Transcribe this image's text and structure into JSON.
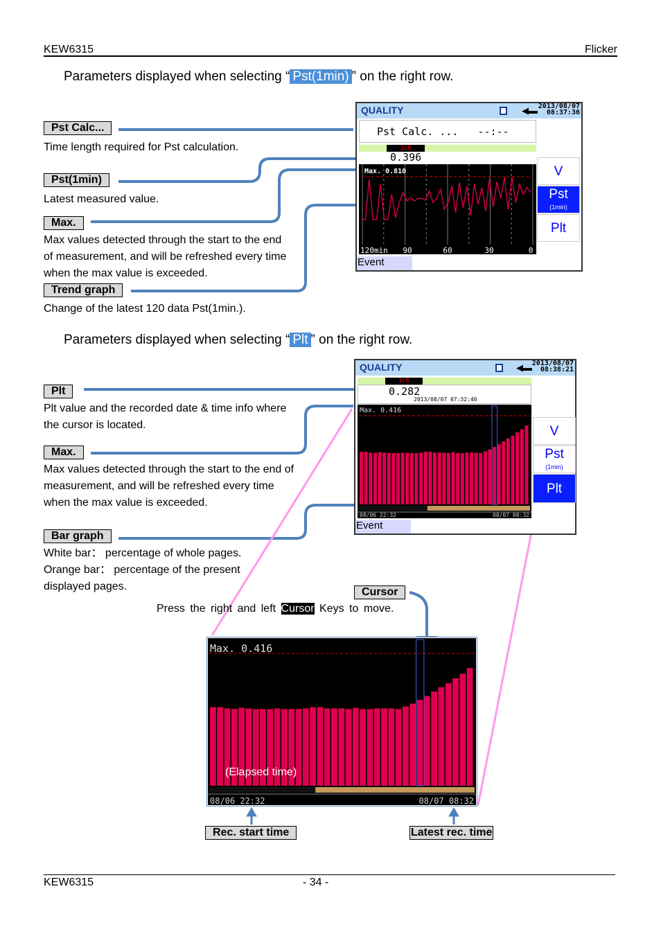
{
  "header": {
    "left": "KEW6315",
    "right": "Flicker"
  },
  "footer": {
    "left": "KEW6315",
    "page": "- 34 -"
  },
  "section1": {
    "pre": "Parameters displayed when selecting “",
    "hl": "Pst(1min)",
    "post": "” on the right row.",
    "items": [
      {
        "label": "Pst Calc...",
        "desc": [
          "Time length required for Pst calculation."
        ]
      },
      {
        "label": "Pst(1min)",
        "desc": [
          "Latest measured value."
        ]
      },
      {
        "label": "Max.",
        "desc": [
          "Max values detected through the start to the end",
          "of measurement, and will be refreshed every time",
          "when the max value is exceeded."
        ]
      },
      {
        "label": "Trend graph",
        "desc": [
          "Change of the latest 120 data Pst(1min.)."
        ]
      }
    ]
  },
  "section2": {
    "pre": "Parameters displayed when selecting “",
    "hl": "Plt",
    "post": "” on the right row.",
    "items": [
      {
        "label": "Plt",
        "desc": [
          "Plt value and the recorded date & time info where",
          "the cursor is located."
        ]
      },
      {
        "label": "Max.",
        "desc": [
          "Max values detected through the start to the end of",
          "measurement, and will be refreshed every time",
          "when the max value is exceeded."
        ]
      },
      {
        "label": "Bar graph",
        "desc": [
          "White bar： percentage of whole pages.",
          "Orange bar： percentage of the present",
          "displayed pages."
        ]
      }
    ]
  },
  "cursor": {
    "label": "Cursor",
    "pre": "Press  the  right  and  left",
    "key": "Cursor",
    "post": "Keys  to  move."
  },
  "zoom": {
    "max": "Max. 0.416",
    "elapsed": "(Elapsed time)",
    "start": "08/06 22:32",
    "end": "08/07 08:32",
    "start_label": "Rec. start time",
    "end_label": "Latest rec. time"
  },
  "screen1": {
    "title": "QUALITY",
    "date": "2013/08/07",
    "time": "08:37:36",
    "calc_label": "Pst Calc. ...",
    "calc_value": "--:--",
    "channel": "1ch",
    "value": "0.396",
    "max": "Max. 0.810",
    "xticks": [
      "120min",
      "90",
      "60",
      "30",
      "0"
    ],
    "event": "Event",
    "side": [
      "V",
      "Pst",
      "(1min)",
      "Plt"
    ],
    "trend": [
      0.3,
      0.3,
      0.78,
      0.3,
      0.3,
      0.72,
      0.3,
      0.3,
      0.6,
      0.32,
      0.5,
      0.62,
      0.52,
      0.56,
      0.52,
      0.55,
      0.55,
      0.53,
      0.64,
      0.5,
      0.56,
      0.66,
      0.42,
      0.5,
      0.7,
      0.38,
      0.74,
      0.44,
      0.7,
      0.35,
      0.72,
      0.48,
      0.68,
      0.4,
      0.78,
      0.45,
      0.75,
      0.55,
      0.8,
      0.42,
      0.81,
      0.5,
      0.72,
      0.6,
      0.68,
      0.62
    ]
  },
  "screen2": {
    "title": "QUALITY",
    "date": "2013/08/07",
    "time": "08:38:21",
    "channel": "1ch",
    "value": "0.282",
    "value_time": "2013/08/07 07:32:46",
    "max": "Max. 0.416",
    "start": "08/06 22:32",
    "end": "08/07 08:32",
    "event": "Event",
    "side": [
      "V",
      "Pst",
      "(1min)",
      "Plt"
    ],
    "plt_max": 0.416,
    "bars": [
      0.247,
      0.247,
      0.243,
      0.241,
      0.245,
      0.243,
      0.241,
      0.241,
      0.241,
      0.243,
      0.241,
      0.241,
      0.241,
      0.243,
      0.247,
      0.247,
      0.243,
      0.243,
      0.243,
      0.241,
      0.245,
      0.241,
      0.241,
      0.243,
      0.243,
      0.243,
      0.241,
      0.249,
      0.258,
      0.27,
      0.282,
      0.296,
      0.31,
      0.322,
      0.338,
      0.352,
      0.37
    ],
    "cursor_index": 29,
    "page_fraction": [
      0.4,
      1.0
    ]
  },
  "colors": {
    "connector": "#4f81bd",
    "pink": "#ff88ee",
    "bar": "#e0004f",
    "highlight": "#4a8fd8"
  }
}
